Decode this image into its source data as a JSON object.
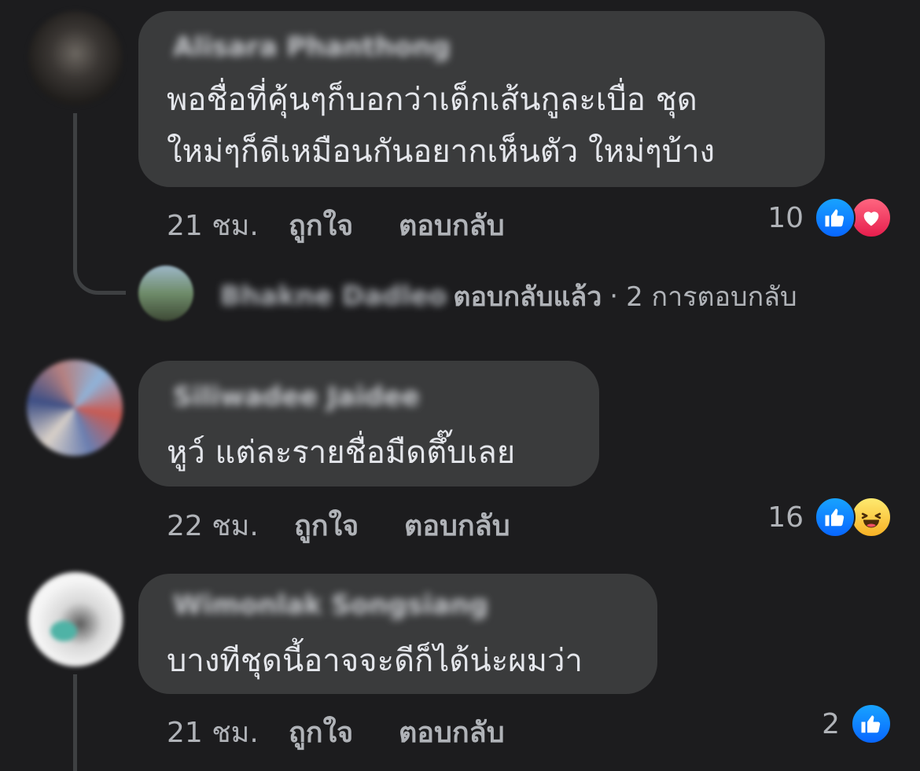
{
  "comments": [
    {
      "author": "Alisara Phanthong",
      "text_lines": [
        "พอชื่อที่คุ้นๆก็บอกว่าเด็กเส้นกูละเบื่อ ชุด",
        "ใหม่ๆก็ดีเหมือนกันอยากเห็นตัว ใหม่ๆบ้าง"
      ],
      "time": "21 ชม.",
      "like_label": "ถูกใจ",
      "reply_label": "ตอบกลับ",
      "reaction_count": "10",
      "reactions": [
        "like-icon",
        "love-icon"
      ],
      "replies": {
        "replier": "Bhakne Dadleo",
        "replied_label": "ตอบกลับแล้ว",
        "separator": "·",
        "reply_count_label": "2 การตอบกลับ"
      }
    },
    {
      "author": "Siliwadee Jaidee",
      "text_lines": [
        "หูว์  แต่ละรายชื่อมืดตึ๊บเลย"
      ],
      "time": "22 ชม.",
      "like_label": "ถูกใจ",
      "reply_label": "ตอบกลับ",
      "reaction_count": "16",
      "reactions": [
        "like-icon",
        "haha-icon"
      ]
    },
    {
      "author": "Wimonlak Songsiang",
      "text_lines": [
        "บางทีชุดนี้อาจจะดีก็ได้น่ะผมว่า"
      ],
      "time": "21 ชม.",
      "like_label": "ถูกใจ",
      "reply_label": "ตอบกลับ",
      "reaction_count": "2",
      "reactions": [
        "like-icon"
      ]
    }
  ],
  "colors": {
    "background": "#1c1c1e",
    "bubble": "#3a3b3c",
    "text": "#e4e6eb",
    "secondary_text": "#b0b3b8",
    "like_blue": "#0866ff",
    "love_red": "#e61e4d",
    "haha_yellow": "#f7b125"
  }
}
